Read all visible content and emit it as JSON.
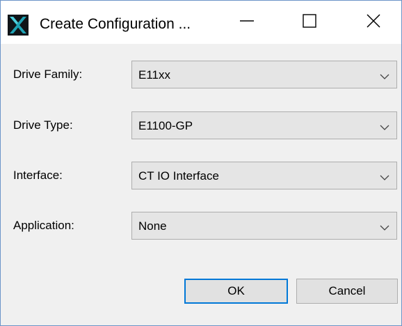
{
  "window": {
    "title": "Create Configuration ...",
    "icon": "app-x-logo-icon",
    "controls": {
      "minimize": "minimize-icon",
      "maximize": "maximize-icon",
      "close": "close-icon"
    }
  },
  "form": {
    "fields": [
      {
        "label": "Drive Family:",
        "value": "E11xx"
      },
      {
        "label": "Drive Type:",
        "value": "E1100-GP"
      },
      {
        "label": "Interface:",
        "value": "CT IO Interface"
      },
      {
        "label": "Application:",
        "value": "None"
      }
    ]
  },
  "buttons": {
    "ok": "OK",
    "cancel": "Cancel"
  },
  "colors": {
    "default_button_border": "#0078d7",
    "window_border": "#6b94c8",
    "dialog_background": "#f0f0f0",
    "combo_background": "#e5e5e5"
  }
}
